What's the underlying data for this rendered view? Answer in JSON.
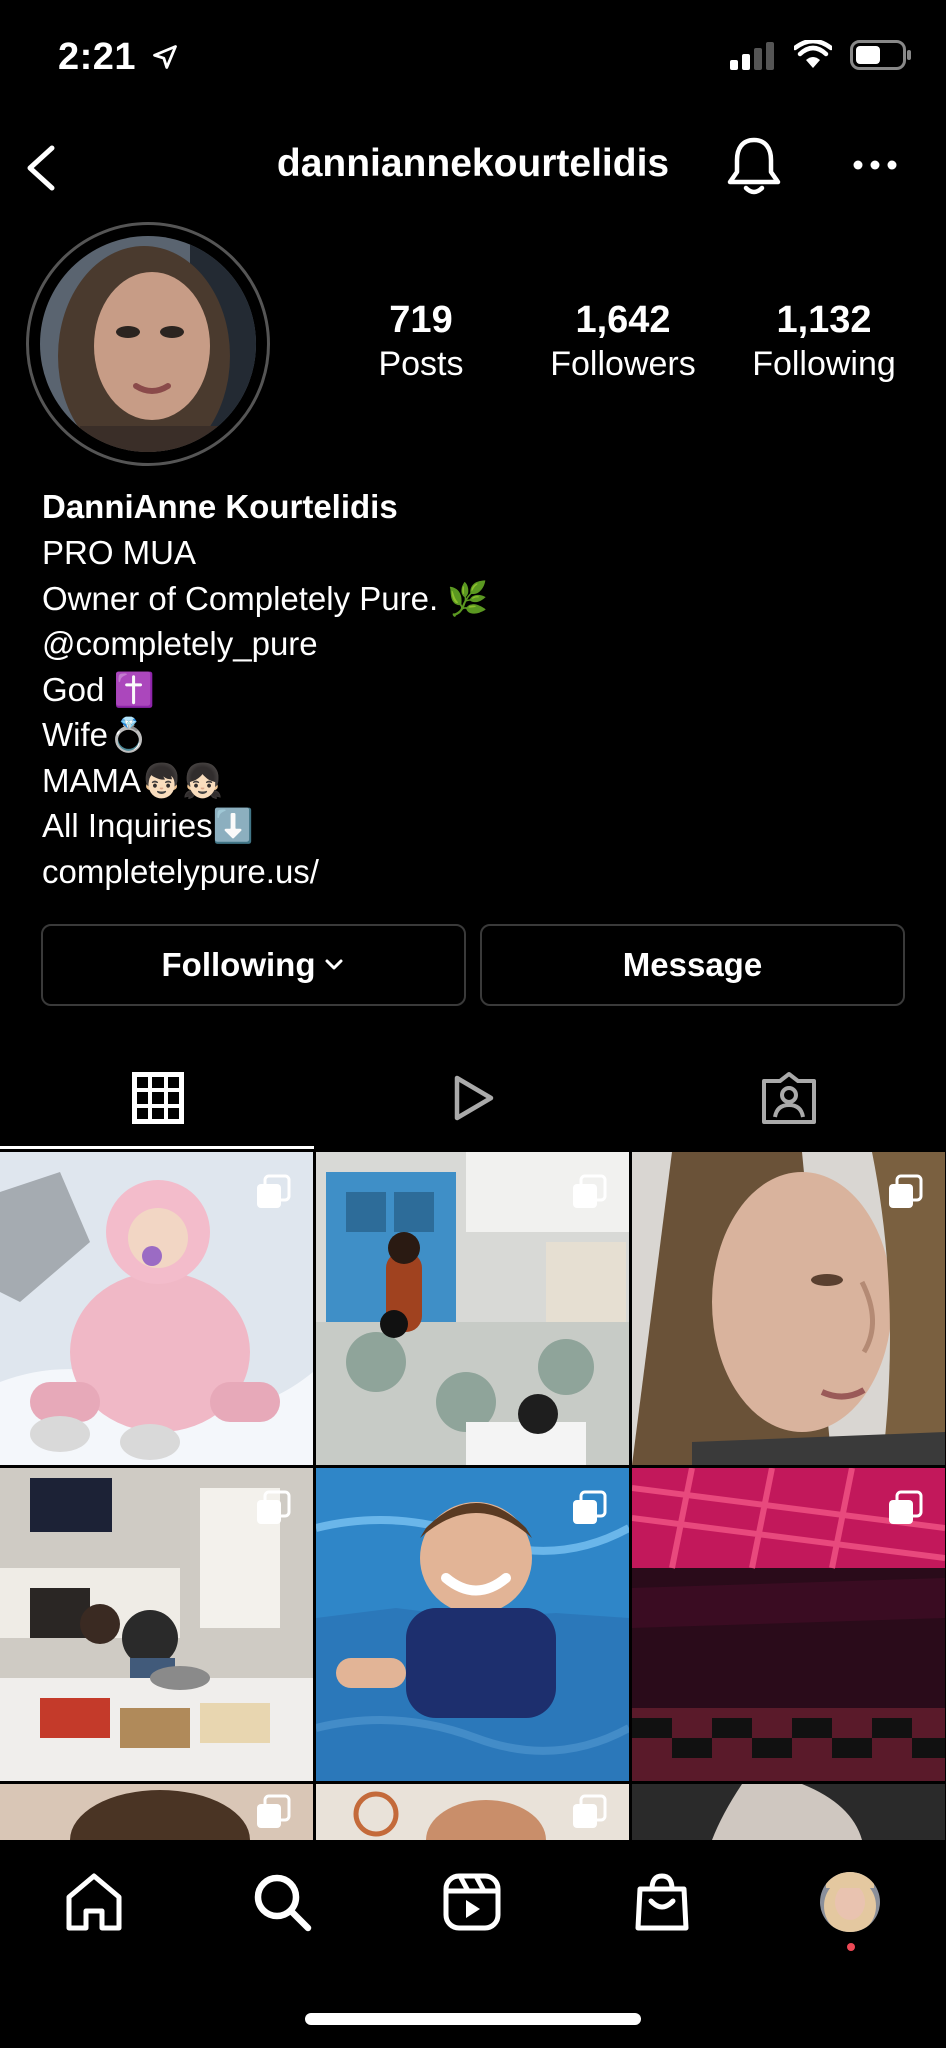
{
  "status_bar": {
    "time": "2:21"
  },
  "header": {
    "username": "danniannekourtelidis"
  },
  "stats": [
    {
      "value": "719",
      "label": "Posts"
    },
    {
      "value": "1,642",
      "label": "Followers"
    },
    {
      "value": "1,132",
      "label": "Following"
    }
  ],
  "bio": {
    "name": "DanniAnne Kourtelidis",
    "lines": [
      "PRO MUA",
      "Owner of Completely Pure. 🌿",
      "@completely_pure",
      "God ✝️",
      "Wife💍",
      "MAMA👦🏻👧🏻",
      "All Inquiries⬇️",
      "completelypure.us/"
    ]
  },
  "buttons": {
    "following": "Following",
    "message": "Message"
  },
  "colors": {
    "background": "#000000",
    "text": "#ffffff",
    "border": "#3a3a3a",
    "notification_dot": "#ed4956"
  }
}
